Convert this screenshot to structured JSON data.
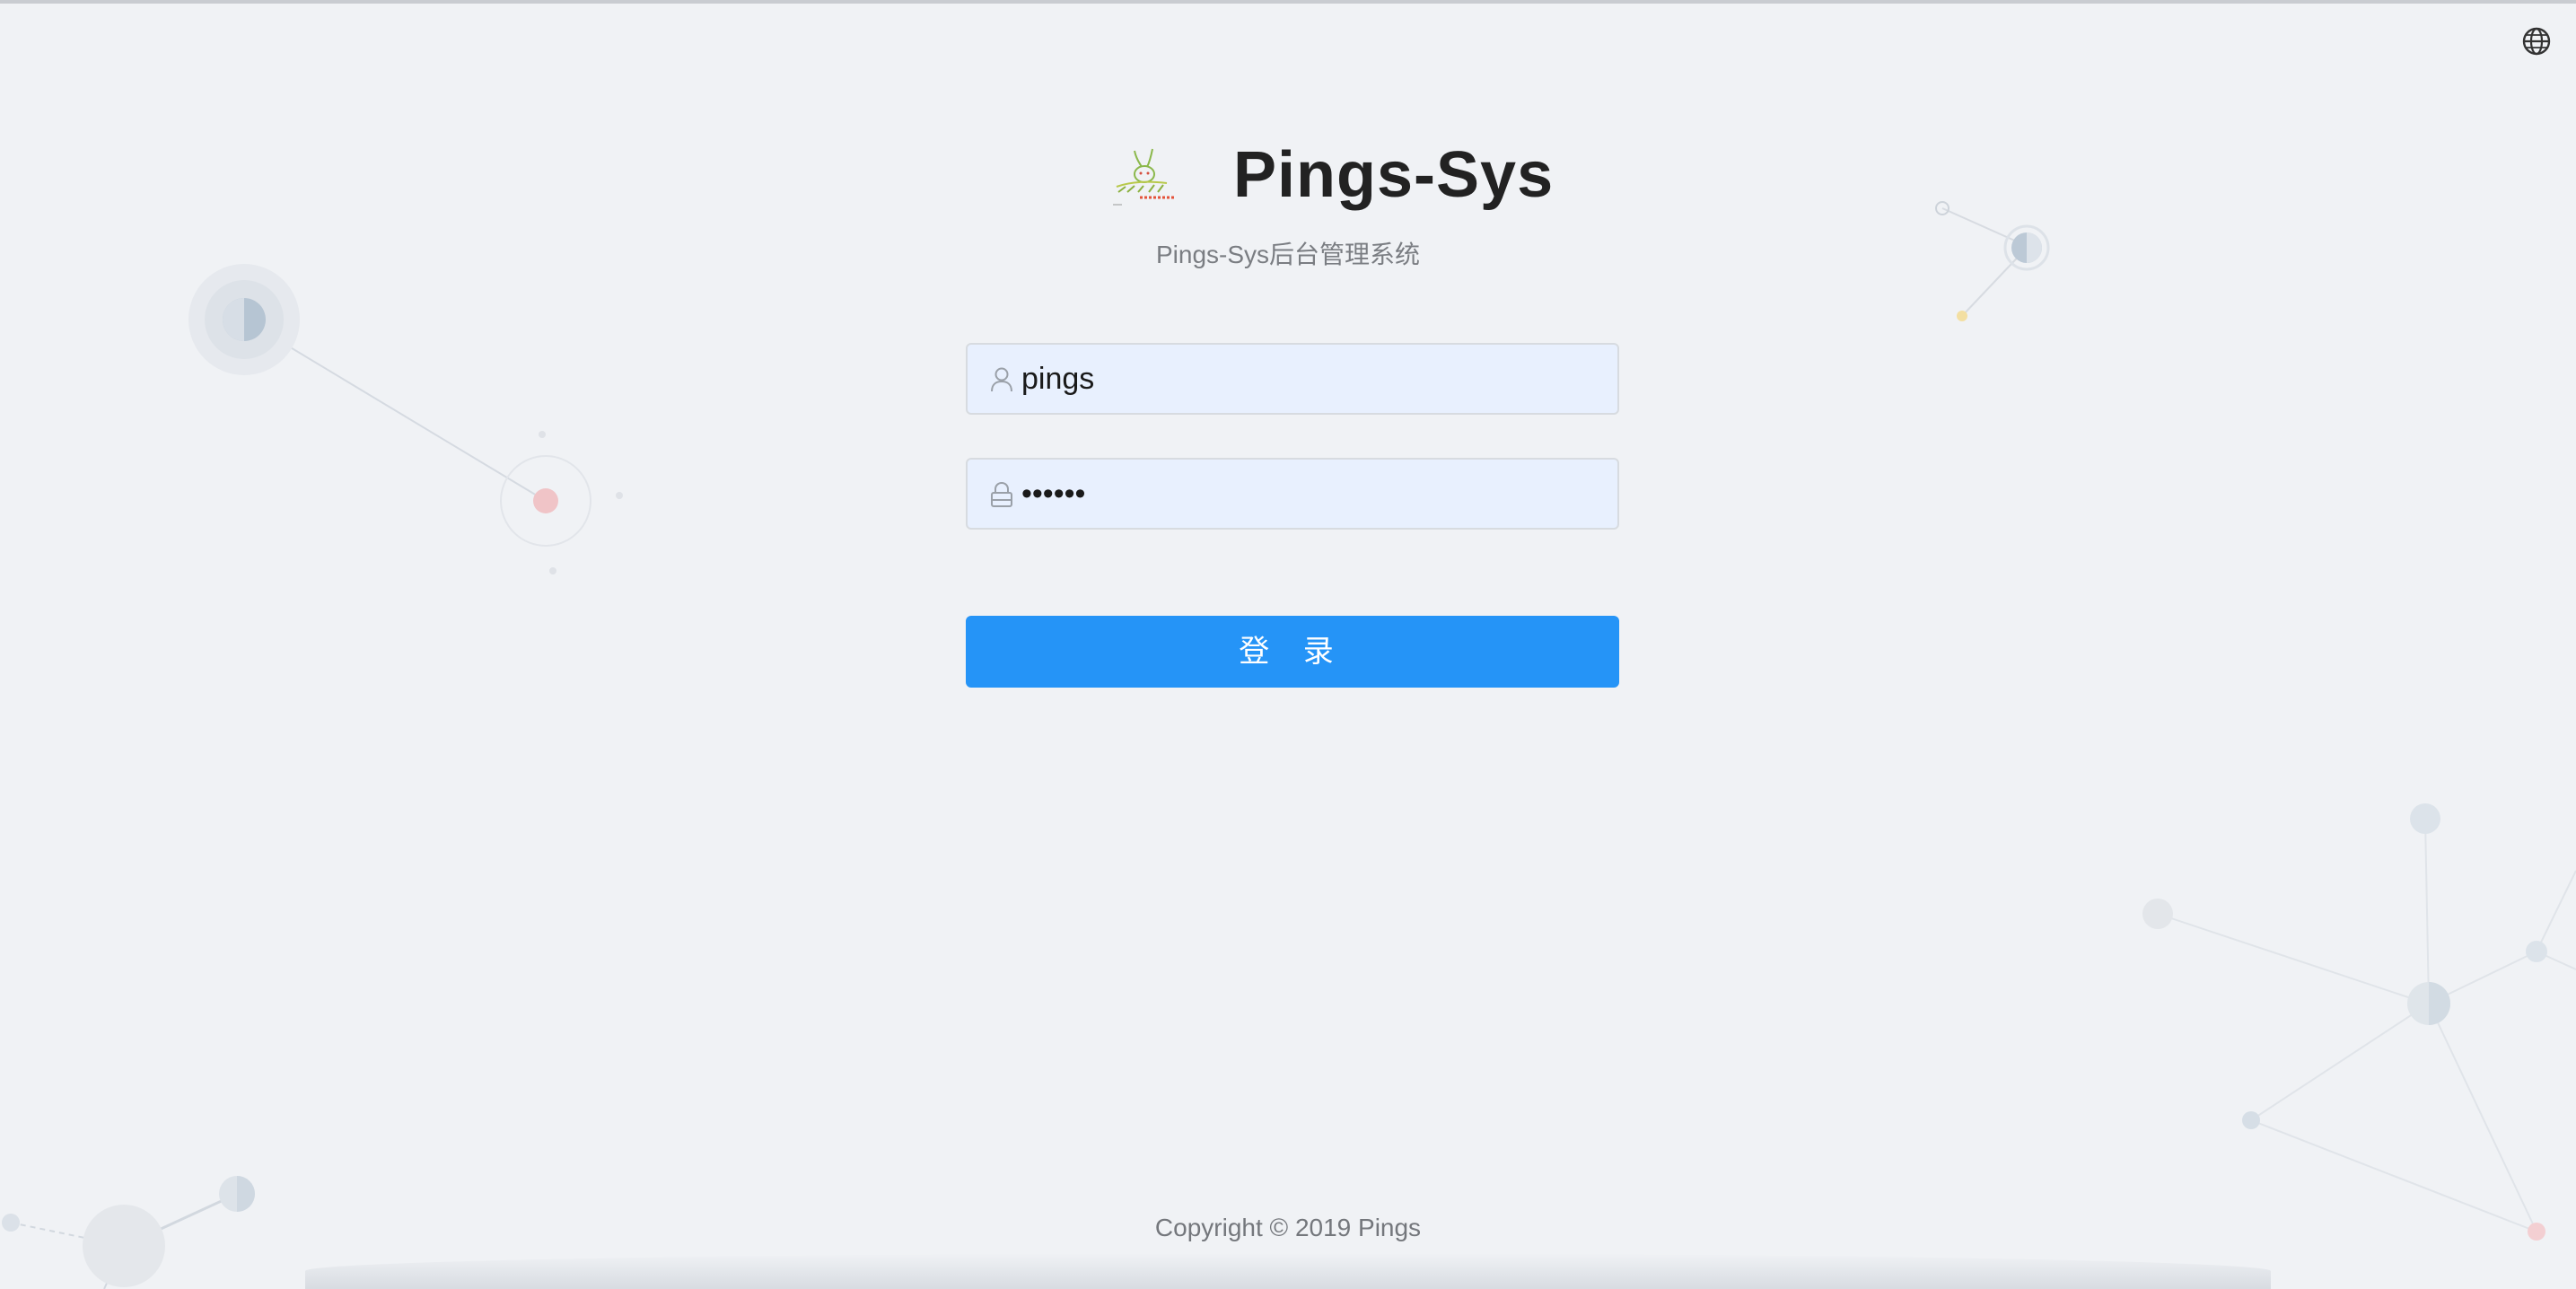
{
  "app": {
    "title": "Pings-Sys",
    "subtitle": "Pings-Sys后台管理系统",
    "logo_icon": "rabbit-logo-icon"
  },
  "language": {
    "icon": "globe-icon"
  },
  "form": {
    "username": {
      "icon": "user-icon",
      "value": "pings"
    },
    "password": {
      "icon": "lock-icon",
      "value": "••••••"
    },
    "login_label": "登 录"
  },
  "footer": {
    "copyright": "Copyright © 2019 Pings"
  },
  "colors": {
    "background": "#f0f2f5",
    "primary": "#2594f7",
    "input_bg": "#e8f0fe"
  }
}
